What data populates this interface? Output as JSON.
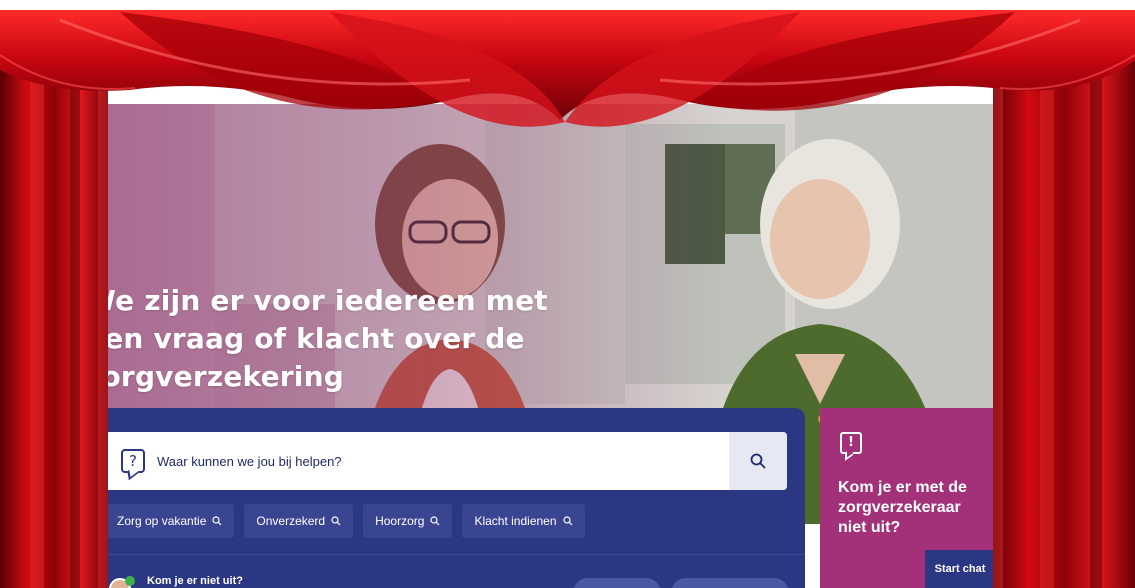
{
  "hero": {
    "title_lines": [
      "We zijn er voor iedereen met",
      "een vraag of klacht over de",
      "zorgverzekering"
    ]
  },
  "search": {
    "placeholder": "Waar kunnen we jou bij helpen?",
    "icon": "question-bubble-icon",
    "button_icon": "search-icon"
  },
  "quick_links": [
    {
      "label": "Zorg op vakantie",
      "icon": "search-icon"
    },
    {
      "label": "Onverzekerd",
      "icon": "search-icon"
    },
    {
      "label": "Hoorzorg",
      "icon": "search-icon"
    },
    {
      "label": "Klacht indienen",
      "icon": "search-icon"
    }
  ],
  "help_bar": {
    "text": "Kom je er niet uit?"
  },
  "chat_card": {
    "icon": "alert-bubble-icon",
    "title": "Kom je er met de zorgverzekeraar niet uit?",
    "button_label": "Start chat"
  },
  "colors": {
    "brand_blue": "#2c3784",
    "brand_magenta": "#a3317a",
    "curtain_red": "#c8050d"
  }
}
